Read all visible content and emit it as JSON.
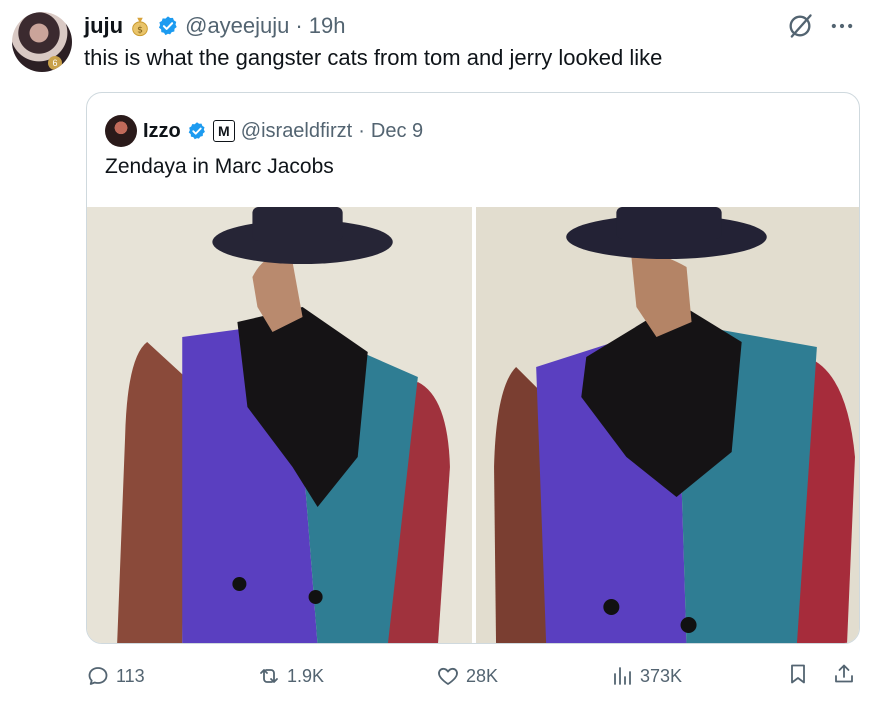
{
  "tweet": {
    "author_name": "juju",
    "author_handle": "@ayeejuju",
    "separator": "·",
    "time": "19h",
    "text": "this is what the gangster cats from tom and jerry looked like",
    "avatar_badge": "6"
  },
  "quoted": {
    "author_name": "Izzo",
    "badge_letter": "M",
    "author_handle": "@israeldfirzt",
    "separator": "·",
    "time": "Dec 9",
    "text": "Zendaya in Marc Jacobs"
  },
  "actions": {
    "replies": "113",
    "reposts": "1.9K",
    "likes": "28K",
    "views": "373K"
  },
  "icons": [
    "money-bag-icon",
    "verified-icon",
    "grok-icon",
    "more-icon",
    "reply-icon",
    "repost-icon",
    "like-icon",
    "views-icon",
    "bookmark-icon",
    "share-icon"
  ],
  "colors": {
    "verified": "#1d9bf0",
    "secondary_text": "#536471",
    "border": "#cfd9de"
  }
}
